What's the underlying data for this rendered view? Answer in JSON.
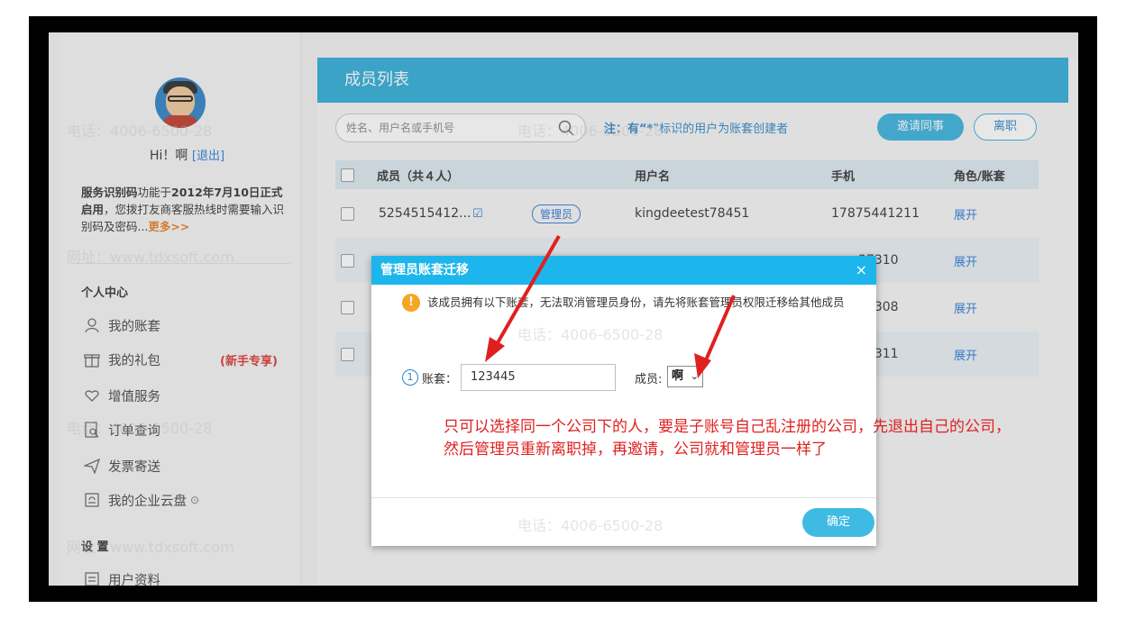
{
  "sidebar": {
    "greeting": "Hi！啊",
    "logout": "[退出]",
    "notice_bold": "服务识别码",
    "notice_text1": "功能于",
    "notice_date": "2012年7月10日正式启用",
    "notice_text2": "，您拨打友商客服热线时需要输入识别码及密码...",
    "notice_more": "更多>>",
    "section_personal": "个人中心",
    "items": [
      {
        "label": "我的账套",
        "icon": "user-icon"
      },
      {
        "label": "我的礼包",
        "icon": "gift-icon"
      },
      {
        "label": "增值服务",
        "icon": "heart-icon"
      },
      {
        "label": "订单查询",
        "icon": "order-search-icon"
      },
      {
        "label": "发票寄送",
        "icon": "send-icon"
      },
      {
        "label": "我的企业云盘",
        "icon": "cloud-disk-icon"
      }
    ],
    "new_badge": "(新手专享)",
    "section_settings": "设 置",
    "settings_items": [
      {
        "label": "用户资料",
        "icon": "profile-icon"
      }
    ]
  },
  "main": {
    "title": "成员列表",
    "search_placeholder": "姓名、用户名或手机号",
    "note_prefix": "注：有“",
    "note_star": "*",
    "note_suffix": "”标识的用户为账套创建者",
    "invite_button": "邀请同事",
    "leave_button": "离职",
    "columns": {
      "member": "成员（共４人）",
      "username": "用户名",
      "phone": "手机",
      "role": "角色/账套"
    },
    "rows": [
      {
        "member": "5254515412...",
        "role_tag": "管理员",
        "username": "kingdeetest78451",
        "phone": "17875441211",
        "action": "展开"
      },
      {
        "member": "",
        "role_tag": "",
        "username": "",
        "phone": "37310",
        "action": "展开"
      },
      {
        "member": "",
        "role_tag": "",
        "username": "",
        "phone": "37308",
        "action": "展开"
      },
      {
        "member": "",
        "role_tag": "",
        "username": "",
        "phone": "37311",
        "action": "展开"
      }
    ]
  },
  "dialog": {
    "title": "管理员账套迁移",
    "close": "×",
    "warning": "该成员拥有以下账套，无法取消管理员身份，请先将账套管理员权限迁移给其他成员",
    "step": "1",
    "account_label": "账套：",
    "account_value": "123445",
    "member_label": "成员:",
    "member_value": "啊",
    "confirm": "确定"
  },
  "annotation": {
    "line1": "只可以选择同一个公司下的人，要是子账号自己乱注册的公司，先退出自己的公司，",
    "line2": "然后管理员重新离职掉，再邀请，公司就和管理员一样了"
  },
  "watermark": {
    "phone": "电话：4006-6500-28",
    "site": "网址：www.tdxsoft.com"
  },
  "colors": {
    "header": "#2cadd7",
    "dialog_header": "#1db6ec",
    "annotation": "#e02020",
    "link": "#2b7ad8"
  }
}
